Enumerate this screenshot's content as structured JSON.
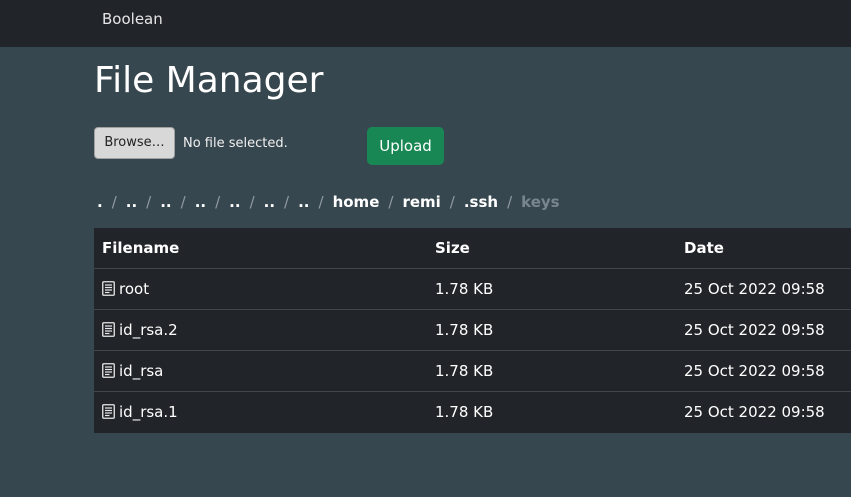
{
  "navbar": {
    "brand": "Boolean"
  },
  "page": {
    "title": "File Manager"
  },
  "upload_form": {
    "browse_label": "Browse…",
    "file_status": "No file selected.",
    "upload_label": "Upload"
  },
  "breadcrumb": {
    "items": [
      ".",
      "..",
      "..",
      "..",
      "..",
      "..",
      "..",
      "home",
      "remi",
      ".ssh",
      "keys"
    ],
    "separator": "/",
    "active": "keys"
  },
  "table": {
    "headers": {
      "filename": "Filename",
      "size": "Size",
      "date": "Date"
    },
    "rows": [
      {
        "name": "root",
        "size": "1.78 KB",
        "date": "25 Oct 2022 09:58",
        "icon": "file-text-icon"
      },
      {
        "name": "id_rsa.2",
        "size": "1.78 KB",
        "date": "25 Oct 2022 09:58",
        "icon": "file-text-icon"
      },
      {
        "name": "id_rsa",
        "size": "1.78 KB",
        "date": "25 Oct 2022 09:58",
        "icon": "file-text-icon"
      },
      {
        "name": "id_rsa.1",
        "size": "1.78 KB",
        "date": "25 Oct 2022 09:58",
        "icon": "file-text-icon"
      }
    ]
  },
  "colors": {
    "page_bg": "#37474f",
    "navbar_bg": "#212529",
    "table_bg": "#212529",
    "upload_button": "#198754",
    "breadcrumb_active": "#78868d"
  }
}
